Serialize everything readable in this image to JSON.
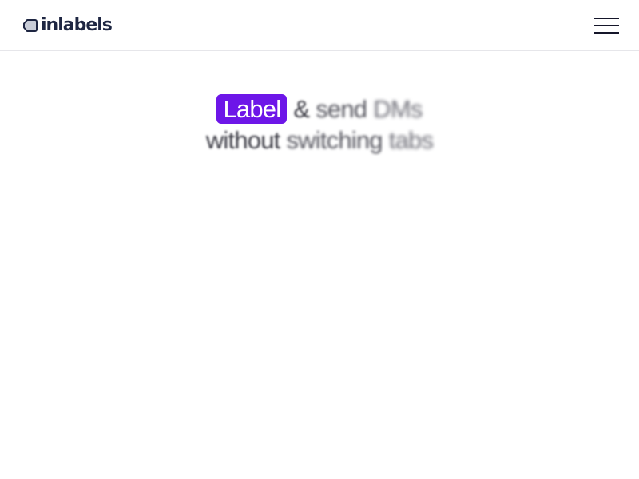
{
  "header": {
    "logo_text": "inlabels",
    "logo_icon": "tag-logo-icon",
    "menu_icon": "hamburger-menu-icon"
  },
  "hero": {
    "line1": {
      "highlight": "Label",
      "w2": "&",
      "w3": "send",
      "w4": "DMs"
    },
    "line2": {
      "w1": "without",
      "w2": "switching",
      "w3": "tabs"
    }
  },
  "colors": {
    "accent": "#6d16e8",
    "logo": "#1e2642",
    "text": "#2a2a33",
    "border": "#e6e6ea"
  }
}
